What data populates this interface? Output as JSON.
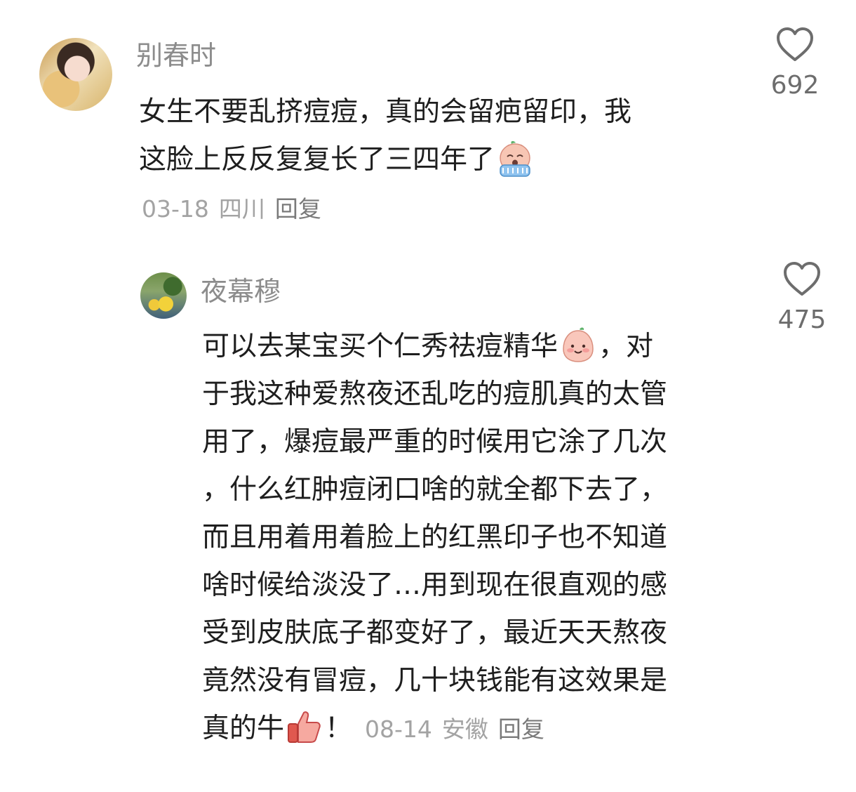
{
  "comments": [
    {
      "username": "别春时",
      "text_lines": [
        "女生不要乱挤痘痘，真的会留疤留印，我",
        "这脸上反反复复长了三四年了"
      ],
      "emoji": "crying-face-emoji",
      "date": "03-18",
      "location": "四川",
      "reply_label": "回复",
      "likes": "692"
    },
    {
      "username": "夜幕穆",
      "text_lines": [
        "可以去某宝买个仁秀祛痘精华",
        "，对",
        "于我这种爱熬夜还乱吃的痘肌真的太管",
        "用了，爆痘最严重的时候用它涂了几次",
        "，什么红肿痘闭口啥的就全都下去了，",
        "而且用着用着脸上的红黑印子也不知道",
        "啥时候给淡没了…用到现在很直观的感",
        "受到皮肤底子都变好了，最近天天熬夜",
        "竟然没有冒痘，几十块钱能有这效果是",
        "真的牛",
        "！"
      ],
      "emojis": [
        "smiling-face-emoji",
        "thumbs-up-emoji"
      ],
      "date": "08-14",
      "location": "安徽",
      "reply_label": "回复",
      "likes": "475"
    }
  ],
  "colors": {
    "text": "#1e1e1e",
    "username": "#8c8c8c",
    "meta": "#a3a3a3",
    "heart_outline": "#6d6d6d"
  }
}
